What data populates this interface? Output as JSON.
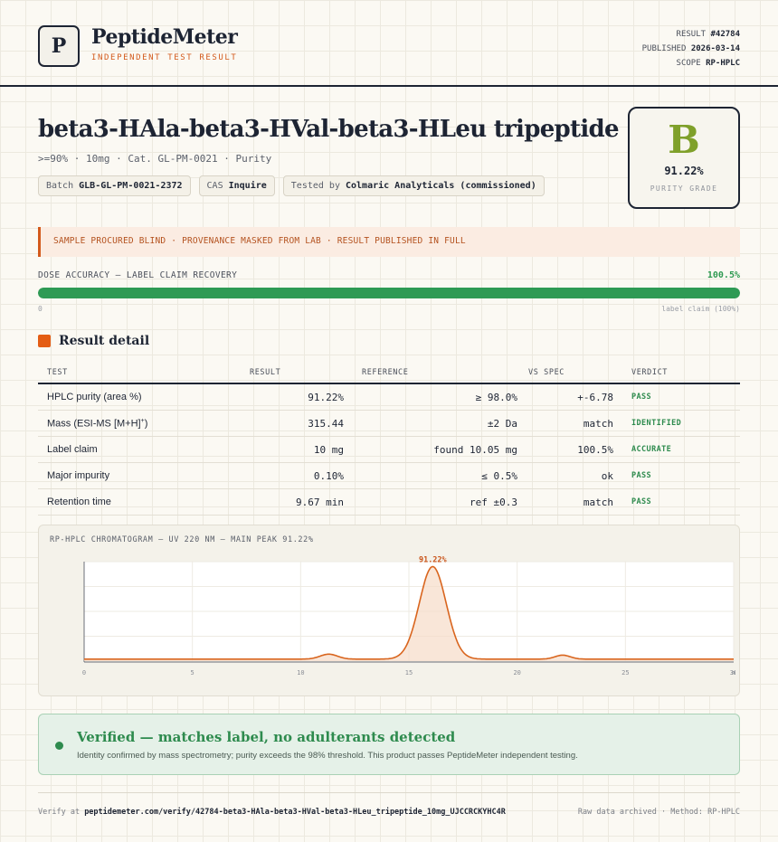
{
  "header": {
    "logo_letter": "P",
    "brand": "PeptideMeter",
    "brand_sub": "INDEPENDENT TEST RESULT",
    "result_label": "RESULT",
    "result_id": "#42784",
    "published_label": "PUBLISHED",
    "published_date": "2026-03-14",
    "scope_label": "SCOPE",
    "scope_value": "RP-HPLC"
  },
  "product": {
    "title": "beta3-HAla-beta3-HVal-beta3-HLeu tripeptide",
    "subtitle": ">=90% · 10mg · Cat. GL-PM-0021 · Purity",
    "chips": [
      {
        "label": "Batch",
        "value": "GLB-GL-PM-0021-2372"
      },
      {
        "label": "CAS",
        "value": "Inquire"
      },
      {
        "label": "Tested by",
        "value": "Colmaric Analyticals (commissioned)"
      }
    ]
  },
  "grade": {
    "letter": "B",
    "value": "91.22%",
    "label": "PURITY GRADE",
    "color": "#7fa02a"
  },
  "notice": "SAMPLE PROCURED BLIND · PROVENANCE MASKED FROM LAB · RESULT PUBLISHED IN FULL",
  "dose": {
    "label": "DOSE ACCURACY — LABEL CLAIM RECOVERY",
    "percent_text": "100.5%",
    "fill_fraction": 1.0,
    "min_label": "0",
    "max_label": "label claim (100%)"
  },
  "section_title": "Result detail",
  "table": {
    "headers": [
      "TEST",
      "RESULT",
      "REFERENCE",
      "VS SPEC",
      "VERDICT"
    ],
    "rows": [
      {
        "test": "HPLC purity (area %)",
        "sup": "",
        "result": "91.22%",
        "reference": "≥ 98.0%",
        "vs": "+-6.78",
        "verdict": "PASS"
      },
      {
        "test": "Mass (ESI-MS [M+H]",
        "sup": "+",
        "suffix": ")",
        "result": "315.44",
        "reference": "±2 Da",
        "vs": "match",
        "verdict": "IDENTIFIED"
      },
      {
        "test": "Label claim",
        "sup": "",
        "result": "10 mg",
        "reference": "found 10.05 mg",
        "vs": "100.5%",
        "verdict": "ACCURATE"
      },
      {
        "test": "Major impurity",
        "sup": "",
        "result": "0.10%",
        "reference": "≤ 0.5%",
        "vs": "ok",
        "verdict": "PASS"
      },
      {
        "test": "Retention time",
        "sup": "",
        "result": "9.67 min",
        "reference": "ref ±0.3",
        "vs": "match",
        "verdict": "PASS"
      }
    ]
  },
  "chart_data": {
    "type": "line",
    "title": "RP-HPLC CHROMATOGRAM — UV 220 NM — MAIN PEAK 91.22%",
    "peak_label": "91.22%",
    "x_unit": "min",
    "xlim": [
      0,
      30
    ],
    "x_ticks": [
      0,
      5,
      10,
      15,
      20,
      25,
      30
    ],
    "ylim": [
      0,
      100
    ],
    "baseline": 2,
    "peaks": [
      {
        "center": 11.3,
        "height": 5,
        "width": 0.4
      },
      {
        "center": 16.1,
        "height": 93,
        "width": 0.62
      },
      {
        "center": 22.1,
        "height": 4,
        "width": 0.35
      }
    ],
    "line_color": "#d9651e",
    "fill_color": "#f7dcc8"
  },
  "verified": {
    "title": "Verified — matches label, no adulterants detected",
    "subtitle": "Identity confirmed by mass spectrometry; purity exceeds the 98% threshold. This product passes PeptideMeter independent testing."
  },
  "footer": {
    "verify_prefix": "Verify at",
    "verify_url": "peptidemeter.com/verify/42784-beta3-HAla-beta3-HVal-beta3-HLeu_tripeptide_10mg_UJCCRCKYHC4R",
    "right": "Raw data archived · Method: RP-HPLC"
  }
}
